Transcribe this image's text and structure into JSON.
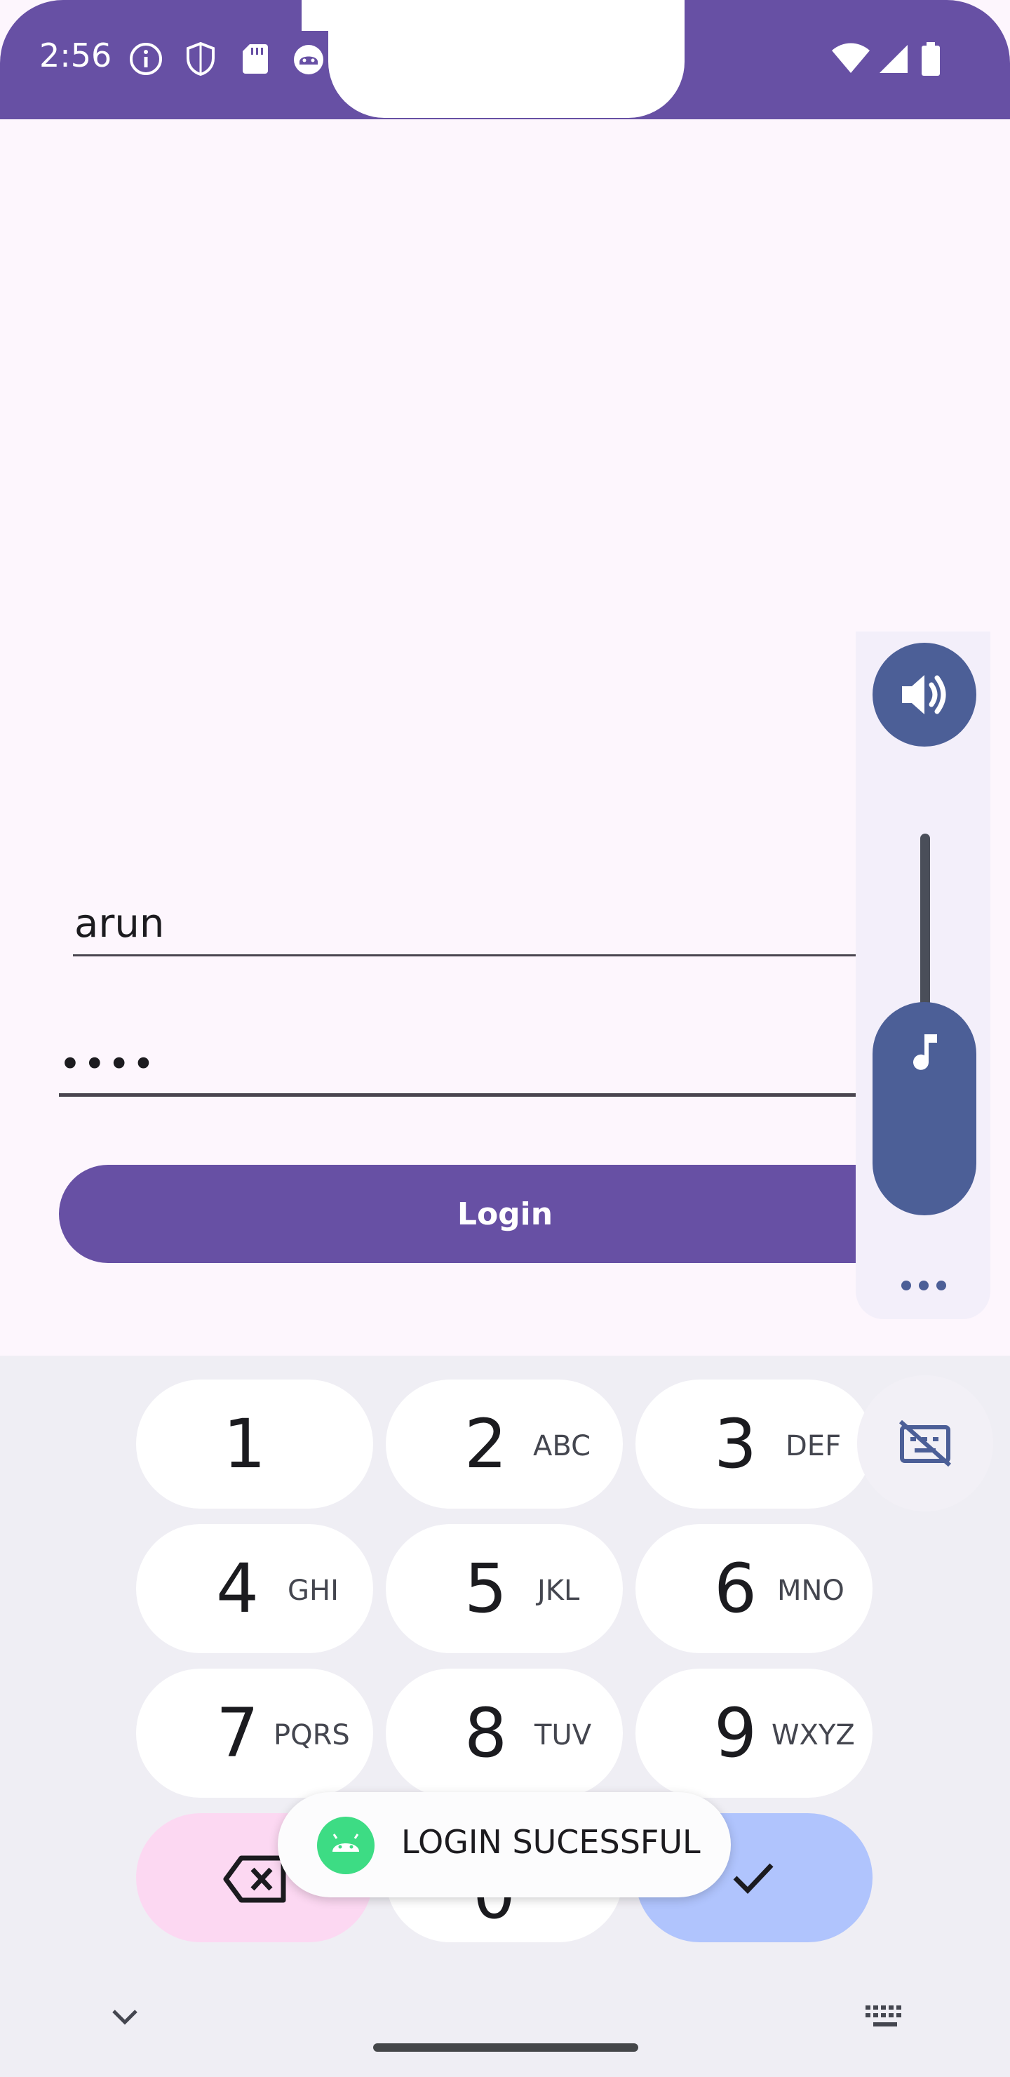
{
  "status_bar": {
    "time": "2:56",
    "left_icons": [
      "info-icon",
      "shield-icon",
      "sd-card-icon",
      "android-robot-icon"
    ],
    "right_icons": [
      "wifi-icon",
      "signal-icon",
      "battery-icon"
    ],
    "background_color": "#6750a4"
  },
  "login_form": {
    "username_value": "arun",
    "password_value": "••••",
    "login_button_label": "Login",
    "accent_color": "#6750a4"
  },
  "volume_panel": {
    "top_icon": "volume-icon",
    "slider_icon": "music-note-icon",
    "more_icon": "more-horizontal-icon",
    "level": 0.45
  },
  "keyboard": {
    "keys": [
      {
        "digit": "1",
        "letters": ""
      },
      {
        "digit": "2",
        "letters": "ABC"
      },
      {
        "digit": "3",
        "letters": "DEF"
      },
      {
        "digit": "4",
        "letters": "GHI"
      },
      {
        "digit": "5",
        "letters": "JKL"
      },
      {
        "digit": "6",
        "letters": "MNO"
      },
      {
        "digit": "7",
        "letters": "PQRS"
      },
      {
        "digit": "8",
        "letters": "TUV"
      },
      {
        "digit": "9",
        "letters": "WXYZ"
      },
      {
        "digit": "0",
        "letters": ""
      }
    ],
    "side_key_icon": "keyboard-off-icon",
    "delete_icon": "backspace-icon",
    "confirm_icon": "check-icon",
    "collapse_icon": "chevron-down-icon",
    "switch_keyboard_icon": "keyboard-icon"
  },
  "toast": {
    "message": "LOGIN SUCESSFUL",
    "icon": "android-icon"
  }
}
